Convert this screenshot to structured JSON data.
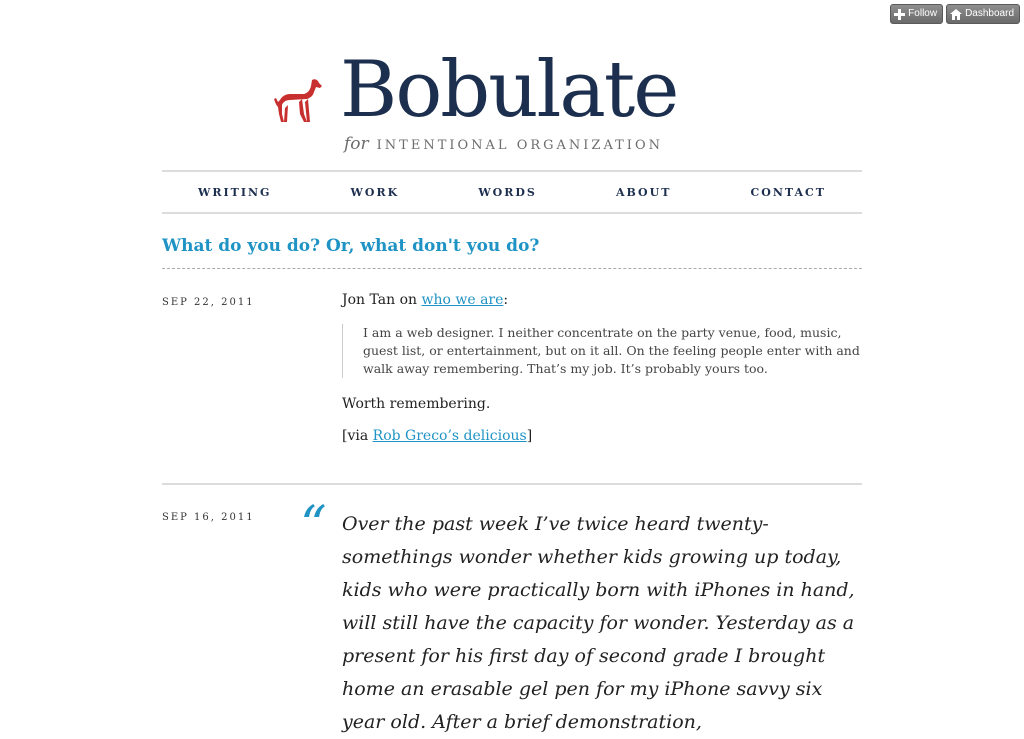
{
  "controls": {
    "follow": "Follow",
    "dashboard": "Dashboard"
  },
  "site": {
    "title": "Bobulate",
    "tagline_for": "for",
    "tagline_rest": "INTENTIONAL ORGANIZATION"
  },
  "nav": [
    "WRITING",
    "WORK",
    "WORDS",
    "ABOUT",
    "CONTACT"
  ],
  "post1": {
    "title": "What do you do? Or, what don't you do?",
    "date": "SEP 22, 2011",
    "lead_author": "Jon Tan on ",
    "lead_link": "who we are",
    "lead_suffix": ":",
    "quote": "I am a web designer. I neither concentrate on the party venue, food, music, guest list, or entertainment, but on it all. On the feeling people enter with and walk away remembering. That’s my job. It’s probably yours too.",
    "worth": "Worth remembering.",
    "via_prefix": "[via ",
    "via_link": "Rob Greco’s delicious",
    "via_suffix": "]"
  },
  "post2": {
    "date": "SEP 16, 2011",
    "quote_mark": "“",
    "text": "Over the past week I’ve twice heard twenty-somethings wonder whether kids growing up today, kids who were practically born with iPhones in hand, will still have the capacity for wonder. Yesterday as a present for his first day of second grade I brought home an erasable gel pen for my iPhone savvy six year old. After a brief demonstration,"
  },
  "colors": {
    "accent": "#1f93c4",
    "brand": "#1d2f4f",
    "dog": "#c8302f"
  }
}
